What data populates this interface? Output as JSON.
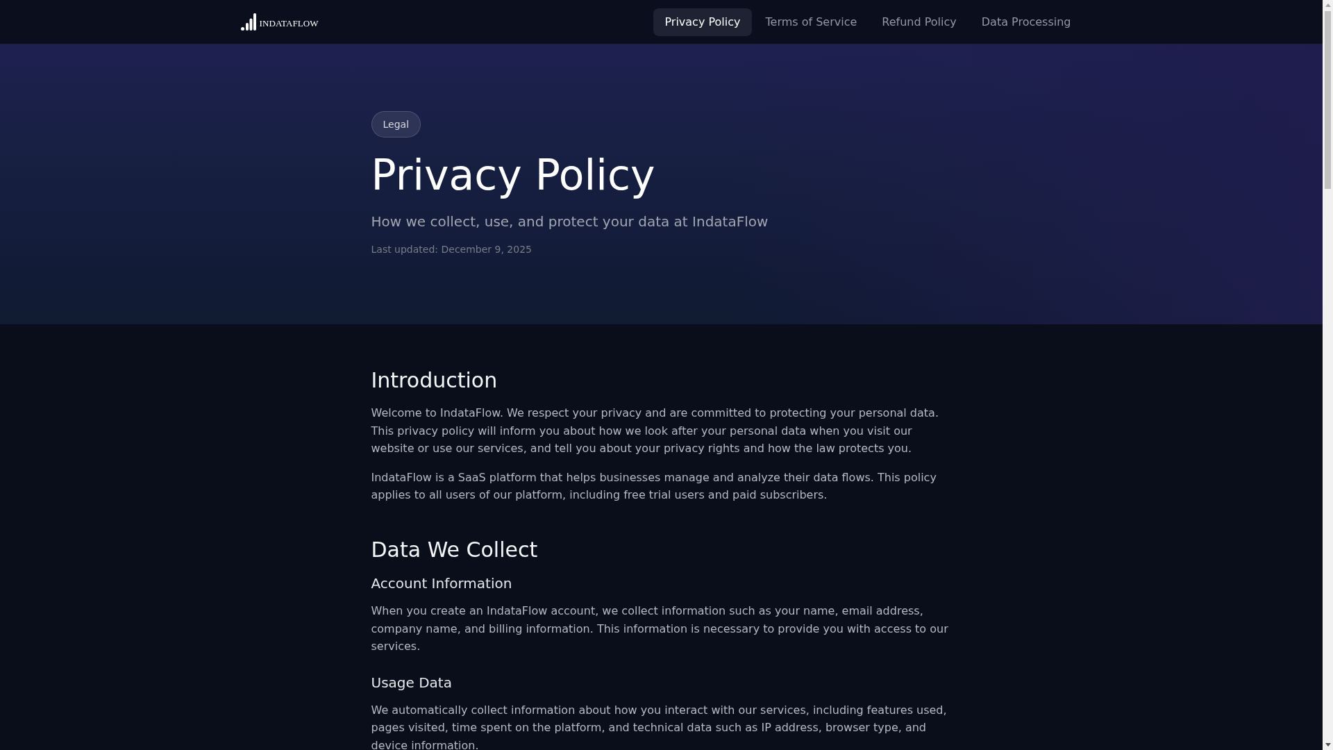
{
  "header": {
    "logo": {
      "text": "INDATAFLOW"
    },
    "nav": [
      {
        "label": "Privacy Policy",
        "selected": true
      },
      {
        "label": "Terms of Service",
        "selected": false
      },
      {
        "label": "Refund Policy",
        "selected": false
      },
      {
        "label": "Data Processing",
        "selected": false
      }
    ]
  },
  "hero": {
    "badge": "Legal",
    "title": "Privacy Policy",
    "subtitle": "How we collect, use, and protect your data at IndataFlow",
    "last_updated": "Last updated: December 9, 2025"
  },
  "sections": [
    {
      "heading": "Introduction",
      "blocks": [
        {
          "kind": "paragraph",
          "text": "Welcome to IndataFlow. We respect your privacy and are committed to protecting your personal data. This privacy policy will inform you about how we look after your personal data when you visit our website or use our services, and tell you about your privacy rights and how the law protects you."
        },
        {
          "kind": "paragraph",
          "text": "IndataFlow is a SaaS platform that helps businesses manage and analyze their data flows. This policy applies to all users of our platform, including free trial users and paid subscribers."
        }
      ]
    },
    {
      "heading": "Data We Collect",
      "blocks": [
        {
          "kind": "subheading",
          "text": "Account Information"
        },
        {
          "kind": "paragraph",
          "text": "When you create an IndataFlow account, we collect information such as your name, email address, company name, and billing information. This information is necessary to provide you with access to our services."
        },
        {
          "kind": "subheading",
          "text": "Usage Data"
        },
        {
          "kind": "paragraph",
          "text": "We automatically collect information about how you interact with our services, including features used, pages visited, time spent on the platform, and technical data such as IP address, browser type, and device information."
        }
      ]
    }
  ]
}
